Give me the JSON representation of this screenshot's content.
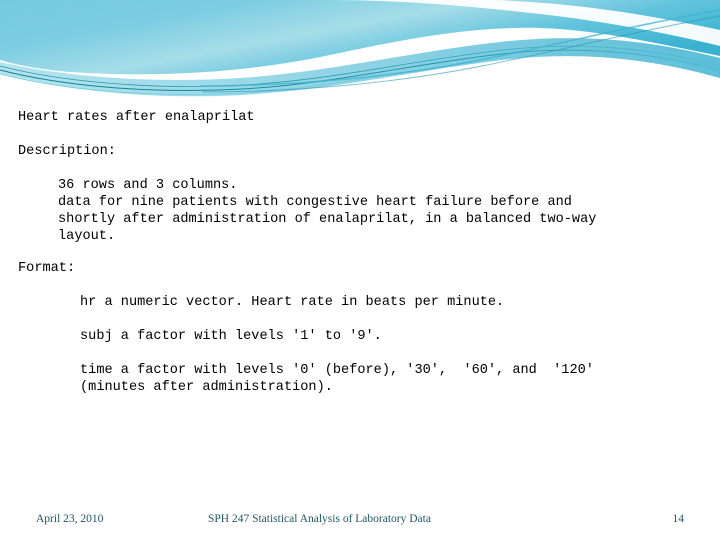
{
  "slide": {
    "title": "Heart rates after enalaprilat",
    "description_label": "Description:",
    "description_lines": [
      "36 rows and 3 columns.",
      "data for nine patients with congestive heart failure before and",
      "shortly after administration of enalaprilat, in a balanced two-way",
      "layout."
    ],
    "format_label": "Format:",
    "format_entries": [
      "hr a numeric vector. Heart rate in beats per minute.",
      "subj a factor with levels '1' to '9'.",
      "time a factor with levels '0' (before), '30',  '60', and  '120'",
      "(minutes after administration)."
    ]
  },
  "footer": {
    "date": "April 23, 2010",
    "course": "SPH 247 Statistical Analysis of Laboratory Data",
    "page_number": "14"
  },
  "theme": {
    "accent_light": "#8fd3e8",
    "accent_mid": "#5dc3da",
    "accent_deep": "#27a7c4",
    "accent_line": "#0f7c8c",
    "footer_text": "#1f5566",
    "body_text": "#000000",
    "background": "#ffffff"
  }
}
